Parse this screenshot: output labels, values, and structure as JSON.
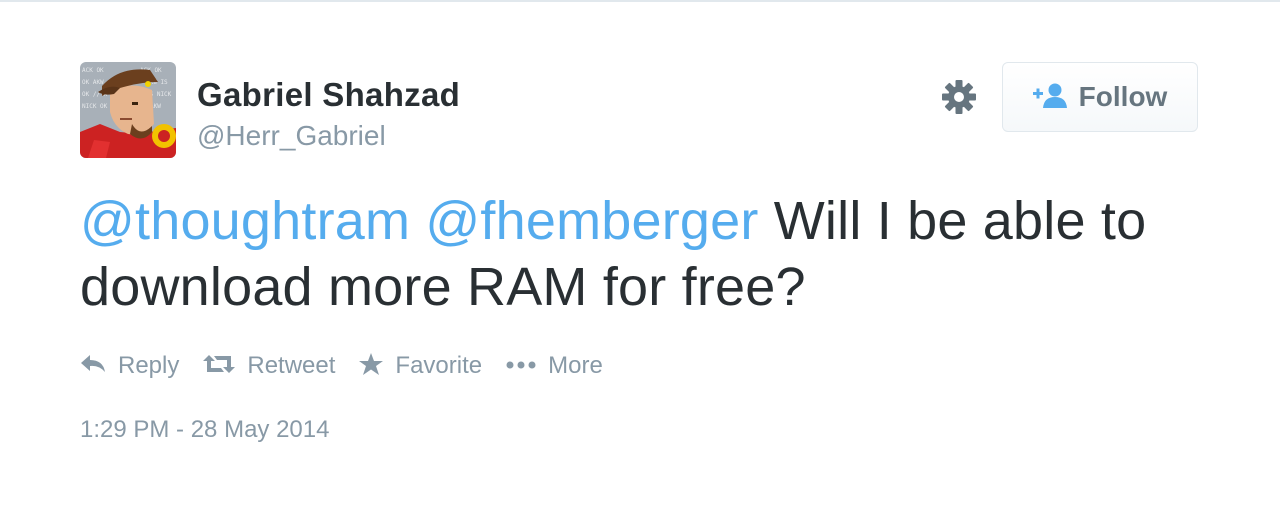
{
  "author": {
    "fullname": "Gabriel Shahzad",
    "screenname": "@Herr_Gabriel"
  },
  "follow_button": {
    "label": "Follow",
    "icon": "add-user-icon"
  },
  "settings_icon": "gear-icon",
  "tweet": {
    "mention1": "@thoughtram",
    "mention2": "@fhemberger",
    "text": " Will I be able to download more RAM for free?"
  },
  "actions": {
    "reply": "Reply",
    "retweet": "Retweet",
    "favorite": "Favorite",
    "more": "More"
  },
  "timestamp": "1:29 PM - 28 May 2014",
  "colors": {
    "link": "#55acee",
    "text": "#292f33",
    "muted": "#8899a6"
  }
}
